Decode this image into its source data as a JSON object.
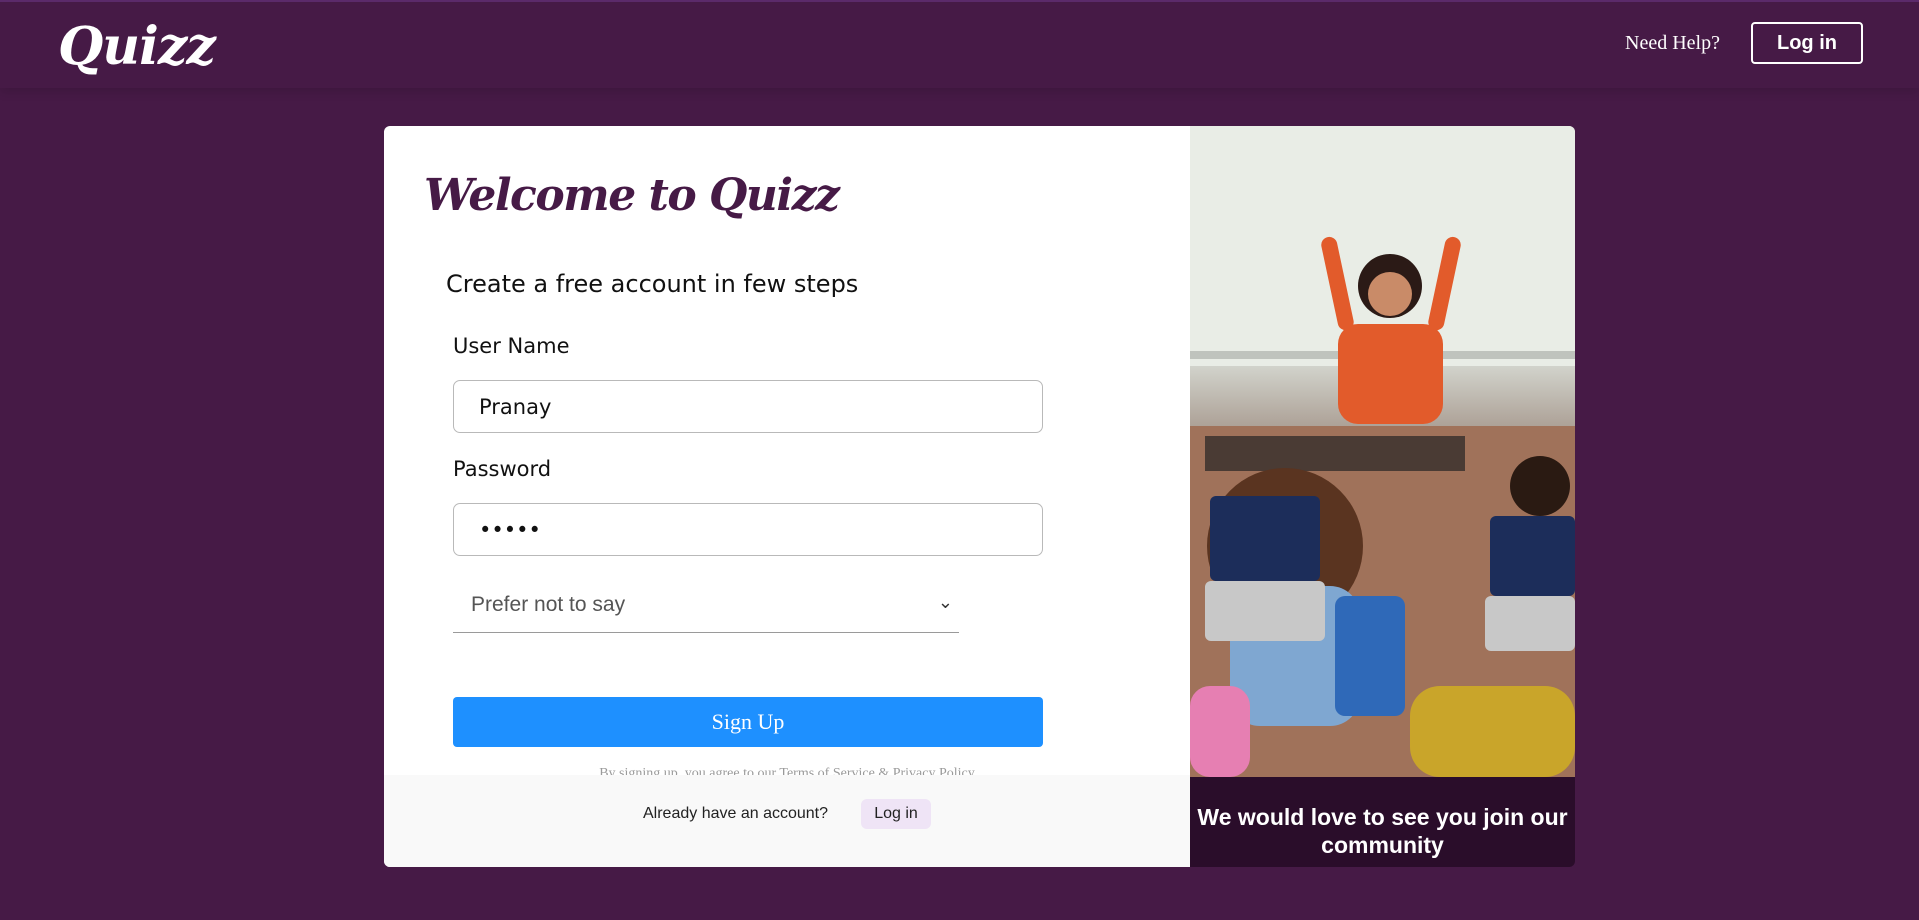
{
  "header": {
    "logo": "Quizz",
    "help_link": "Need Help?",
    "login_label": "Log in"
  },
  "form": {
    "title": "Welcome to Quizz",
    "subtitle": "Create a free account in few steps",
    "username_label": "User Name",
    "username_value": "Pranay",
    "password_label": "Password",
    "password_value": "•••••",
    "gender_selected": "Prefer not to say",
    "signup_label": "Sign Up",
    "terms_text": "By signing up, you agree to our Terms of Service & Privacy Policy",
    "already_have_account": "Already have an account?",
    "footer_login_label": "Log in"
  },
  "side": {
    "caption": "We would love to see you join our community"
  },
  "colors": {
    "background": "#461a46",
    "primary_button": "#1e90ff",
    "caption_bg": "#2a0d2a"
  }
}
